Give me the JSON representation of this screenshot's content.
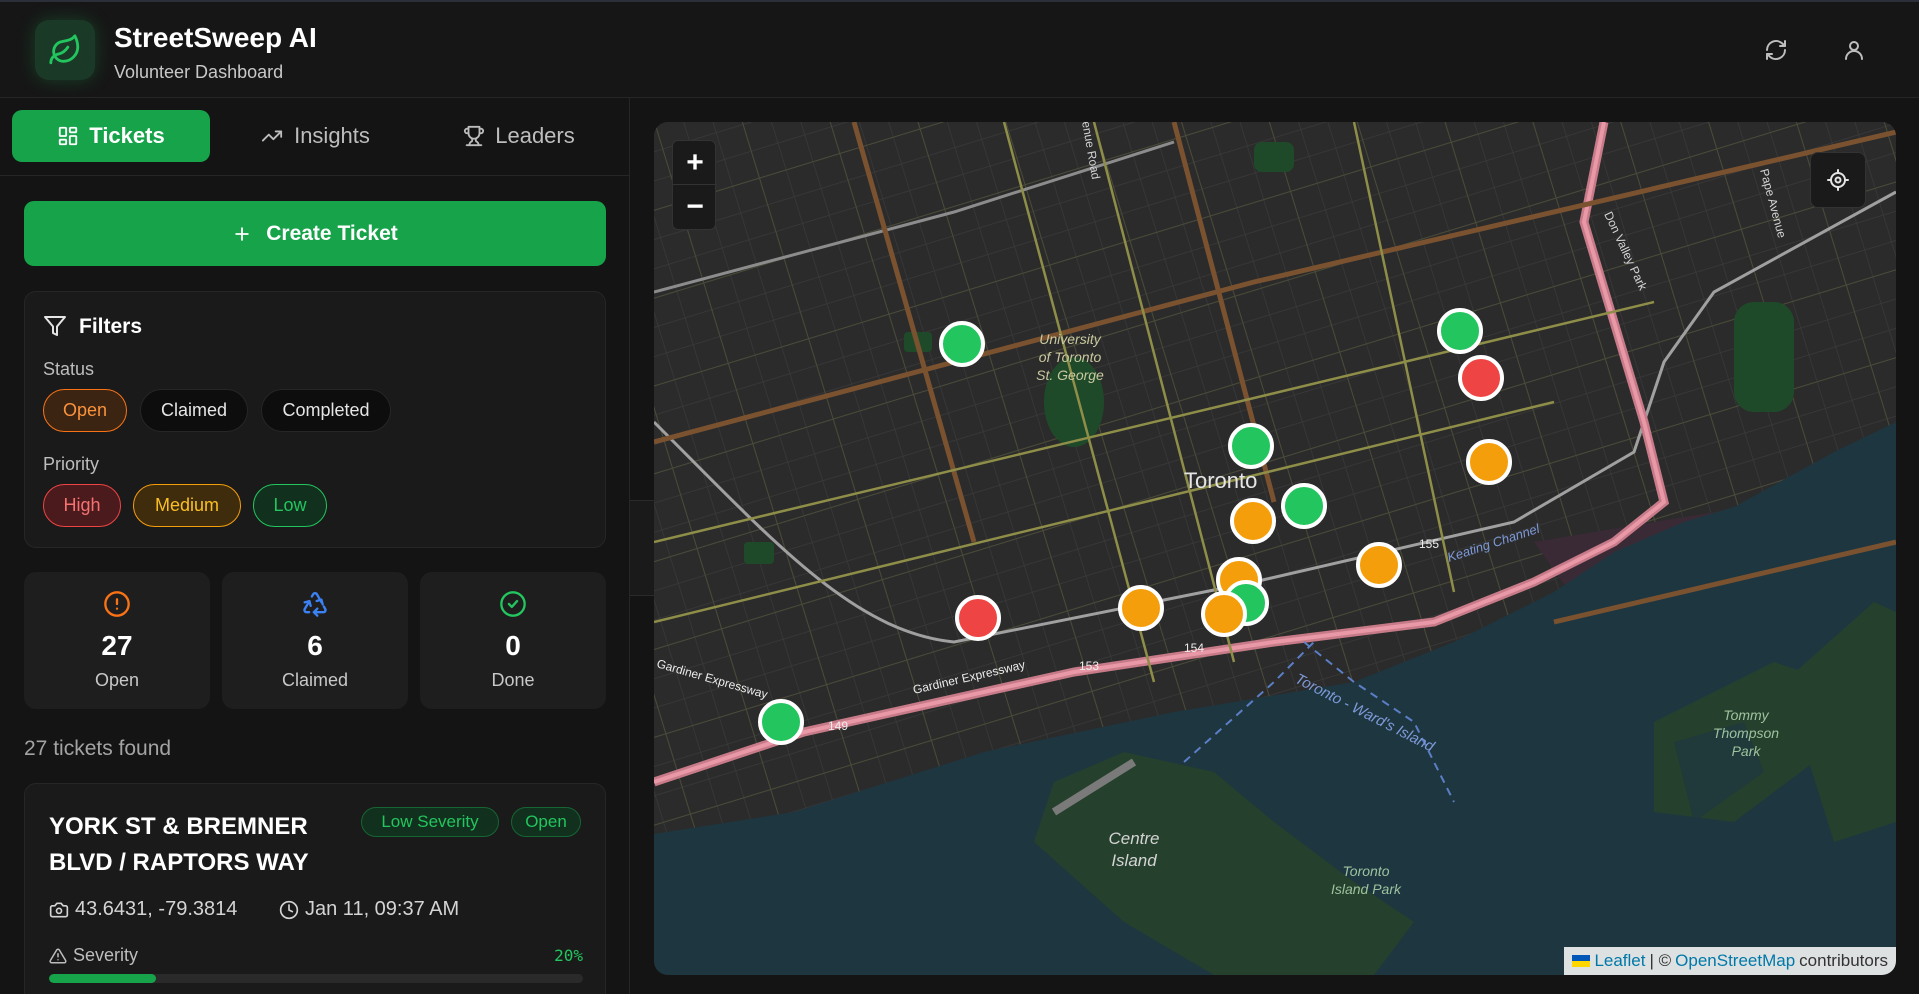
{
  "app": {
    "title": "StreetSweep AI",
    "subtitle": "Volunteer Dashboard"
  },
  "header": {
    "icons": [
      "refresh-icon",
      "user-icon"
    ]
  },
  "tabs": [
    {
      "label": "Tickets",
      "icon": "grid-icon",
      "active": true
    },
    {
      "label": "Insights",
      "icon": "trend-icon",
      "active": false
    },
    {
      "label": "Leaders",
      "icon": "trophy-icon",
      "active": false
    }
  ],
  "create_button": {
    "label": "Create Ticket"
  },
  "filters": {
    "title": "Filters",
    "status_label": "Status",
    "status": [
      {
        "label": "Open",
        "selected": true
      },
      {
        "label": "Claimed",
        "selected": false
      },
      {
        "label": "Completed",
        "selected": false
      }
    ],
    "priority_label": "Priority",
    "priority": [
      {
        "label": "High"
      },
      {
        "label": "Medium"
      },
      {
        "label": "Low"
      }
    ]
  },
  "stats": [
    {
      "value": "27",
      "label": "Open",
      "color": "#f97316"
    },
    {
      "value": "6",
      "label": "Claimed",
      "color": "#3b82f6"
    },
    {
      "value": "0",
      "label": "Done",
      "color": "#22c55e"
    }
  ],
  "tickets_found": "27 tickets found",
  "ticket": {
    "title": "YORK ST & BREMNER BLVD / RAPTORS WAY",
    "severity_badge": "Low Severity",
    "status_badge": "Open",
    "coords": "43.6431, -79.3814",
    "time": "Jan 11, 09:37 AM",
    "severity_label": "Severity",
    "severity_value": "20%",
    "severity_fraction": 0.2
  },
  "map": {
    "zoom_in": "+",
    "zoom_out": "−",
    "labels": {
      "city": "Toronto",
      "university": [
        "University",
        "of Toronto",
        "St. George"
      ],
      "centre_island": [
        "Centre",
        "Island"
      ],
      "toronto_island_park": [
        "Toronto",
        "Island Park"
      ],
      "tommy_thompson": [
        "Tommy",
        "Thompson",
        "Park"
      ],
      "ferry": "Toronto - Ward's Island",
      "gardiner": "Gardiner Expressway",
      "gardiner_left": "Gardiner Expressway",
      "keating": "Keating Channel",
      "don_valley": "Don Valley Park",
      "pape": "Pape Avenue",
      "avenue_road": "enue Road",
      "route_149": "149",
      "route_153": "153",
      "route_154": "154",
      "route_155": "155"
    },
    "attribution": {
      "leaflet": "Leaflet",
      "separator": "| ©",
      "osm": "OpenStreetMap",
      "contributors": "contributors"
    },
    "marker_colors": {
      "low": "#22c55e",
      "medium": "#f59e0b",
      "high": "#ef4444"
    },
    "markers": [
      {
        "priority": "low"
      },
      {
        "priority": "low"
      },
      {
        "priority": "high"
      },
      {
        "priority": "low"
      },
      {
        "priority": "medium"
      },
      {
        "priority": "low"
      },
      {
        "priority": "medium"
      },
      {
        "priority": "medium"
      },
      {
        "priority": "medium"
      },
      {
        "priority": "medium"
      },
      {
        "priority": "low"
      },
      {
        "priority": "medium"
      },
      {
        "priority": "high"
      },
      {
        "priority": "low"
      }
    ]
  }
}
